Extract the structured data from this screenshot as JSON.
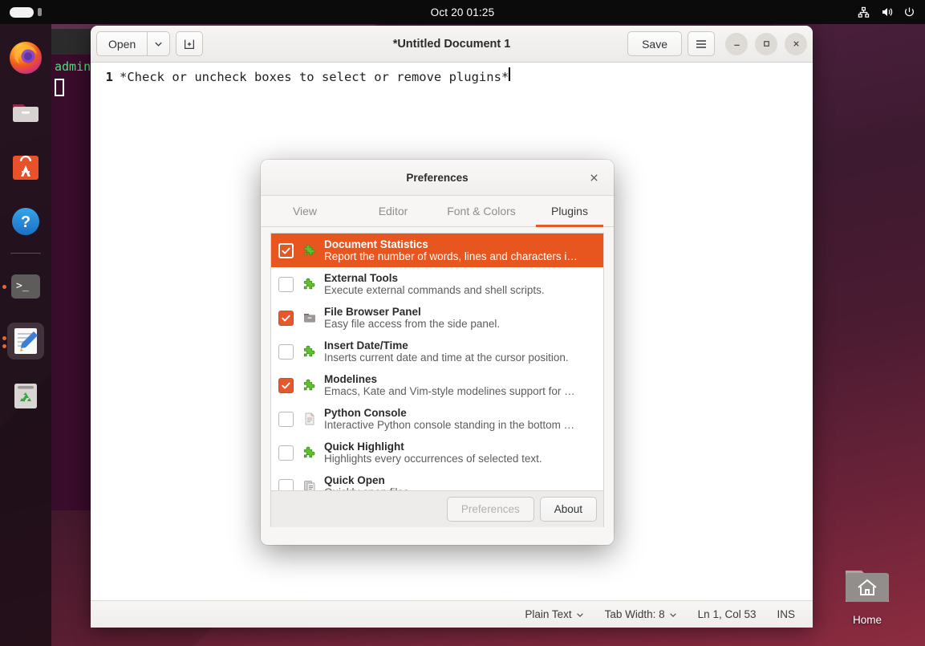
{
  "topbar": {
    "clock": "Oct 20  01:25",
    "icons": [
      "network-icon",
      "volume-icon",
      "power-icon"
    ]
  },
  "dock": {
    "items": [
      {
        "name": "firefox",
        "label": "Firefox",
        "running": false,
        "active": false
      },
      {
        "name": "files",
        "label": "Files",
        "running": false,
        "active": false
      },
      {
        "name": "ubuntu-software",
        "label": "Ubuntu Software",
        "running": false,
        "active": false
      },
      {
        "name": "help",
        "label": "Help",
        "running": false,
        "active": false
      },
      {
        "name": "terminal",
        "label": "Terminal",
        "running": true,
        "active": false
      },
      {
        "name": "gedit",
        "label": "Text Editor",
        "running": true,
        "active": true
      },
      {
        "name": "trash",
        "label": "Trash",
        "running": false,
        "active": false
      }
    ]
  },
  "desktop": {
    "home_icon_label": "Home"
  },
  "terminal": {
    "prompt": "admin"
  },
  "gedit": {
    "open_label": "Open",
    "save_label": "Save",
    "title": "*Untitled Document 1",
    "new_tab_icon": "new-tab-icon",
    "menu_icon": "hamburger-menu-icon",
    "window_controls": [
      "minimize-icon",
      "maximize-icon",
      "close-icon"
    ],
    "document": {
      "line_number": "1",
      "text": "*Check or uncheck boxes to select or remove plugins*"
    },
    "statusbar": {
      "language": "Plain Text",
      "tab_width": "Tab Width: 8",
      "position": "Ln 1, Col 53",
      "insert_mode": "INS"
    }
  },
  "preferences": {
    "title": "Preferences",
    "close_icon": "close-icon",
    "tabs": [
      {
        "label": "View",
        "active": false
      },
      {
        "label": "Editor",
        "active": false
      },
      {
        "label": "Font & Colors",
        "active": false
      },
      {
        "label": "Plugins",
        "active": true
      }
    ],
    "plugins": [
      {
        "name": "Document Statistics",
        "description": "Report the number of words, lines and characters i…",
        "checked": true,
        "selected": true,
        "icon": "puzzle-piece-icon"
      },
      {
        "name": "External Tools",
        "description": "Execute external commands and shell scripts.",
        "checked": false,
        "selected": false,
        "icon": "puzzle-piece-icon"
      },
      {
        "name": "File Browser Panel",
        "description": "Easy file access from the side panel.",
        "checked": true,
        "selected": false,
        "icon": "folder-icon"
      },
      {
        "name": "Insert Date/Time",
        "description": "Inserts current date and time at the cursor position.",
        "checked": false,
        "selected": false,
        "icon": "puzzle-piece-icon"
      },
      {
        "name": "Modelines",
        "description": "Emacs, Kate and Vim-style modelines support for …",
        "checked": true,
        "selected": false,
        "icon": "puzzle-piece-icon"
      },
      {
        "name": "Python Console",
        "description": "Interactive Python console standing in the bottom …",
        "checked": false,
        "selected": false,
        "icon": "document-icon"
      },
      {
        "name": "Quick Highlight",
        "description": "Highlights every occurrences of selected text.",
        "checked": false,
        "selected": false,
        "icon": "puzzle-piece-icon"
      },
      {
        "name": "Quick Open",
        "description": "Quickly open files",
        "checked": false,
        "selected": false,
        "icon": "copy-documents-icon"
      }
    ],
    "actions": {
      "preferences_label": "Preferences",
      "preferences_enabled": false,
      "about_label": "About",
      "about_enabled": true
    }
  },
  "colors": {
    "accent_orange": "#e85620",
    "checkbox_orange": "#e8572a",
    "topbar_black": "#0b0b0b",
    "terminal_green": "#4ee07a"
  }
}
